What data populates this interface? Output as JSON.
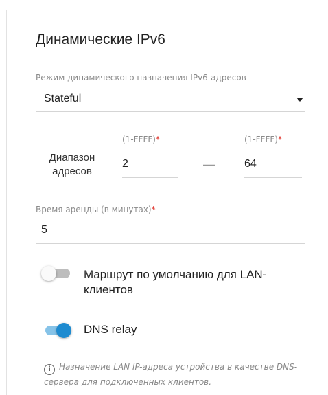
{
  "section": {
    "title": "Динамические IPv6"
  },
  "mode": {
    "label": "Режим динамического назначения IPv6-адресов",
    "value": "Stateful"
  },
  "range": {
    "label_line1": "Диапазон",
    "label_line2": "адресов",
    "start_hint": "(1-FFFF)",
    "end_hint": "(1-FFFF)",
    "required_mark": "*",
    "start_value": "2",
    "end_value": "64",
    "separator": "—"
  },
  "lease": {
    "label": "Время аренды (в минутах)",
    "required_mark": "*",
    "value": "5"
  },
  "default_route": {
    "label": "Маршрут по умолчанию для LAN-клиентов",
    "enabled": false
  },
  "dns_relay": {
    "label": "DNS relay",
    "enabled": true
  },
  "info": {
    "icon": "info-icon",
    "text": "Назначение LAN IP-адреса устройства в качестве DNS-сервера для подключенных клиентов."
  },
  "colors": {
    "accent": "#1e8bd0",
    "required": "#e0322a"
  }
}
